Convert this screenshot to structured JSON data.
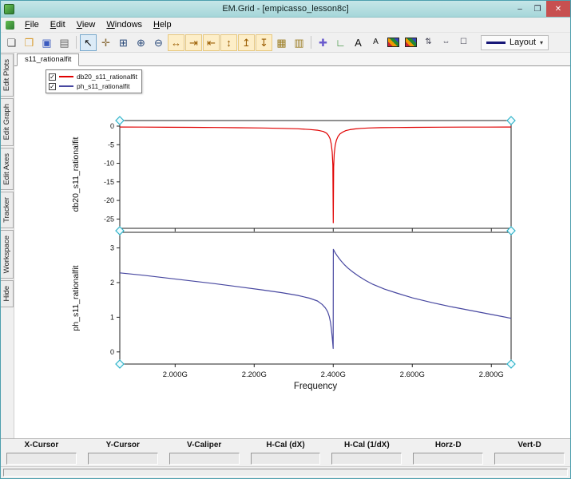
{
  "theme": {
    "titlebar": "#a5d6d9",
    "titlebar_hi": "#c6e6e8",
    "window_border": "#4e9fae",
    "close_button": "#c75050"
  },
  "window": {
    "title": "EM.Grid - [empicasso_lesson8c]",
    "minimize": "–",
    "maximize": "❐",
    "close": "✕"
  },
  "menu": {
    "items": [
      {
        "label": "File"
      },
      {
        "label": "Edit"
      },
      {
        "label": "View"
      },
      {
        "label": "Windows"
      },
      {
        "label": "Help"
      }
    ]
  },
  "toolbar": {
    "layout": {
      "label": "Layout",
      "caret": "▾"
    },
    "icons": [
      {
        "name": "new-file-icon",
        "glyph": "❏",
        "color": "#555"
      },
      {
        "name": "open-folder-icon",
        "glyph": "❒",
        "color": "#d79b2e"
      },
      {
        "name": "save-icon",
        "glyph": "▣",
        "color": "#3b5bbf"
      },
      {
        "name": "print-icon",
        "glyph": "▤",
        "color": "#666"
      },
      {
        "sep": true
      },
      {
        "name": "select-arrow-icon",
        "glyph": "↖",
        "color": "#111",
        "selected": true
      },
      {
        "name": "pan-icon",
        "glyph": "✛",
        "color": "#8a6d3b"
      },
      {
        "name": "zoom-window-icon",
        "glyph": "⊞",
        "color": "#2a4a7a"
      },
      {
        "name": "zoom-in-icon",
        "glyph": "⊕",
        "color": "#2a4a7a"
      },
      {
        "name": "zoom-out-icon",
        "glyph": "⊖",
        "color": "#2a4a7a"
      },
      {
        "name": "fit-x-icon",
        "glyph": "↔",
        "color": "#9a5c00",
        "amber": true
      },
      {
        "name": "expand-x-icon",
        "glyph": "⇥",
        "color": "#9a5c00",
        "amber": true
      },
      {
        "name": "shrink-x-icon",
        "glyph": "⇤",
        "color": "#9a5c00",
        "amber": true
      },
      {
        "name": "fit-y-icon",
        "glyph": "↕",
        "color": "#9a5c00",
        "amber": true
      },
      {
        "name": "expand-y-icon",
        "glyph": "↥",
        "color": "#9a5c00",
        "amber": true
      },
      {
        "name": "shrink-y-icon",
        "glyph": "↧",
        "color": "#9a5c00",
        "amber": true
      },
      {
        "name": "grid-icon",
        "glyph": "▦",
        "color": "#9a7b20"
      },
      {
        "name": "snap-grid-icon",
        "glyph": "▥",
        "color": "#9a7b20"
      },
      {
        "sep": true
      },
      {
        "name": "add-marker-icon",
        "glyph": "✚",
        "color": "#6a5acd"
      },
      {
        "name": "add-axes-icon",
        "glyph": "∟",
        "color": "#2e8b2e"
      },
      {
        "name": "add-text-icon",
        "glyph": "A",
        "color": "#111"
      },
      {
        "name": "font-icon",
        "glyph": "A",
        "color": "#111",
        "small": true
      },
      {
        "name": "image-icon",
        "swatch": true
      },
      {
        "name": "copy-image-icon",
        "swatch": true
      },
      {
        "name": "spin-box-icon",
        "glyph": "⇅",
        "color": "#445",
        "small": true
      },
      {
        "name": "caliper-icon",
        "glyph": "⇔",
        "color": "#445",
        "small": true
      },
      {
        "name": "frame-box-icon",
        "glyph": "☐",
        "color": "#445",
        "small": true
      }
    ]
  },
  "side_tabs": [
    {
      "label": "Edit Plots"
    },
    {
      "label": "Edit Graph"
    },
    {
      "label": "Edit Axes"
    },
    {
      "label": "Tracker"
    },
    {
      "label": "Workspace"
    },
    {
      "label": "Hide"
    }
  ],
  "plot_tab": "s11_rationalfit",
  "legend": {
    "items": [
      {
        "label": "db20_s11_rationalfit",
        "color": "#e00000",
        "checked": true
      },
      {
        "label": "ph_s11_rationalfit",
        "color": "#4747a0",
        "checked": true
      }
    ]
  },
  "cursor_table": {
    "headers": [
      "X-Cursor",
      "Y-Cursor",
      "V-Caliper",
      "H-Cal (dX)",
      "H-Cal (1/dX)",
      "Horz-D",
      "Vert-D"
    ],
    "values": [
      "",
      "",
      "",
      "",
      "",
      "",
      ""
    ]
  },
  "chart_data": [
    {
      "type": "line",
      "title": "",
      "xlabel": "",
      "ylabel": "db20_s11_rationalfit",
      "xlim": [
        1.86,
        2.85
      ],
      "ylim": [
        -27.5,
        1.5
      ],
      "xticks": [
        2.0,
        2.2,
        2.4,
        2.6,
        2.8
      ],
      "xtick_labels": [],
      "yticks": [
        0,
        -5,
        -10,
        -15,
        -20,
        -25
      ],
      "grid": false,
      "series": [
        {
          "name": "db20_s11_rationalfit",
          "color": "#e00000",
          "x": [
            1.86,
            1.92,
            1.98,
            2.04,
            2.1,
            2.16,
            2.22,
            2.27,
            2.31,
            2.34,
            2.36,
            2.375,
            2.383,
            2.388,
            2.392,
            2.395,
            2.3975,
            2.399,
            2.4,
            2.401,
            2.4025,
            2.405,
            2.408,
            2.412,
            2.417,
            2.424,
            2.432,
            2.442,
            2.455,
            2.47,
            2.49,
            2.52,
            2.56,
            2.61,
            2.67,
            2.73,
            2.79,
            2.85
          ],
          "y": [
            -0.25,
            -0.27,
            -0.3,
            -0.33,
            -0.37,
            -0.43,
            -0.5,
            -0.6,
            -0.72,
            -0.9,
            -1.1,
            -1.45,
            -1.9,
            -2.5,
            -3.4,
            -4.8,
            -7,
            -10.5,
            -26,
            -11,
            -7.5,
            -5.2,
            -3.8,
            -2.8,
            -2.1,
            -1.6,
            -1.2,
            -0.95,
            -0.75,
            -0.6,
            -0.5,
            -0.42,
            -0.36,
            -0.32,
            -0.29,
            -0.27,
            -0.26,
            -0.25
          ]
        }
      ]
    },
    {
      "type": "line",
      "title": "",
      "xlabel": "Frequency",
      "ylabel": "ph_s11_rationalfit",
      "xlim": [
        1.86,
        2.85
      ],
      "ylim": [
        -0.35,
        3.45
      ],
      "xticks": [
        2.0,
        2.2,
        2.4,
        2.6,
        2.8
      ],
      "xtick_labels": [
        "2.000G",
        "2.200G",
        "2.400G",
        "2.600G",
        "2.800G"
      ],
      "yticks": [
        0,
        1,
        2,
        3
      ],
      "grid": false,
      "series": [
        {
          "name": "ph_s11_rationalfit",
          "color": "#4747a0",
          "x": [
            1.86,
            1.92,
            1.98,
            2.04,
            2.1,
            2.16,
            2.22,
            2.27,
            2.31,
            2.34,
            2.36,
            2.372,
            2.38,
            2.386,
            2.39,
            2.393,
            2.3955,
            2.3975,
            2.399,
            2.3998,
            2.4002,
            2.402,
            2.405,
            2.409,
            2.414,
            2.42,
            2.428,
            2.438,
            2.45,
            2.465,
            2.482,
            2.5,
            2.53,
            2.56,
            2.6,
            2.65,
            2.7,
            2.75,
            2.8,
            2.85
          ],
          "y": [
            2.28,
            2.21,
            2.13,
            2.05,
            1.97,
            1.88,
            1.79,
            1.71,
            1.63,
            1.55,
            1.47,
            1.37,
            1.27,
            1.16,
            1.02,
            0.86,
            0.65,
            0.42,
            0.22,
            0.1,
            2.96,
            2.92,
            2.86,
            2.79,
            2.71,
            2.62,
            2.52,
            2.41,
            2.3,
            2.18,
            2.06,
            1.95,
            1.81,
            1.7,
            1.56,
            1.42,
            1.3,
            1.19,
            1.08,
            0.97
          ]
        }
      ]
    }
  ]
}
